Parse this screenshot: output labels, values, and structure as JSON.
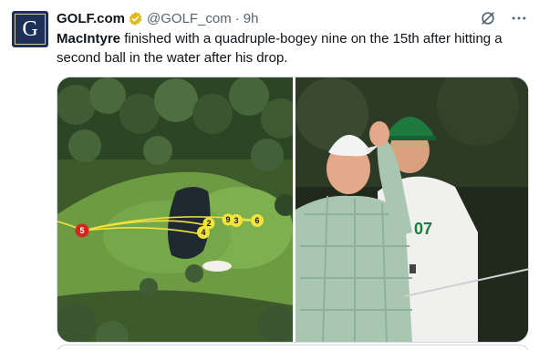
{
  "account": {
    "avatar_letter": "G",
    "display_name": "GOLF.com",
    "handle": "@GOLF_com",
    "separator": "·",
    "time": "9h",
    "brand_color": "#1d3158",
    "verified_color": "#e2b719"
  },
  "tweet": {
    "name_bold": "MacIntyre",
    "body": " finished with a quadruple-bogey nine on the 15th after hitting a second ball in the water after his drop."
  },
  "media": {
    "left_panel": {
      "icon": "hole-map-graphic",
      "shot_markers": [
        "5",
        "4",
        "2",
        "3",
        "9",
        "6"
      ],
      "marker_colors": {
        "first": "#d9241e",
        "others": "#f2e33a"
      }
    },
    "right_panel": {
      "icon": "golfer-photo",
      "bib_number": "07"
    }
  },
  "icons": [
    "verified-badge-icon",
    "grok-icon",
    "more-icon"
  ]
}
